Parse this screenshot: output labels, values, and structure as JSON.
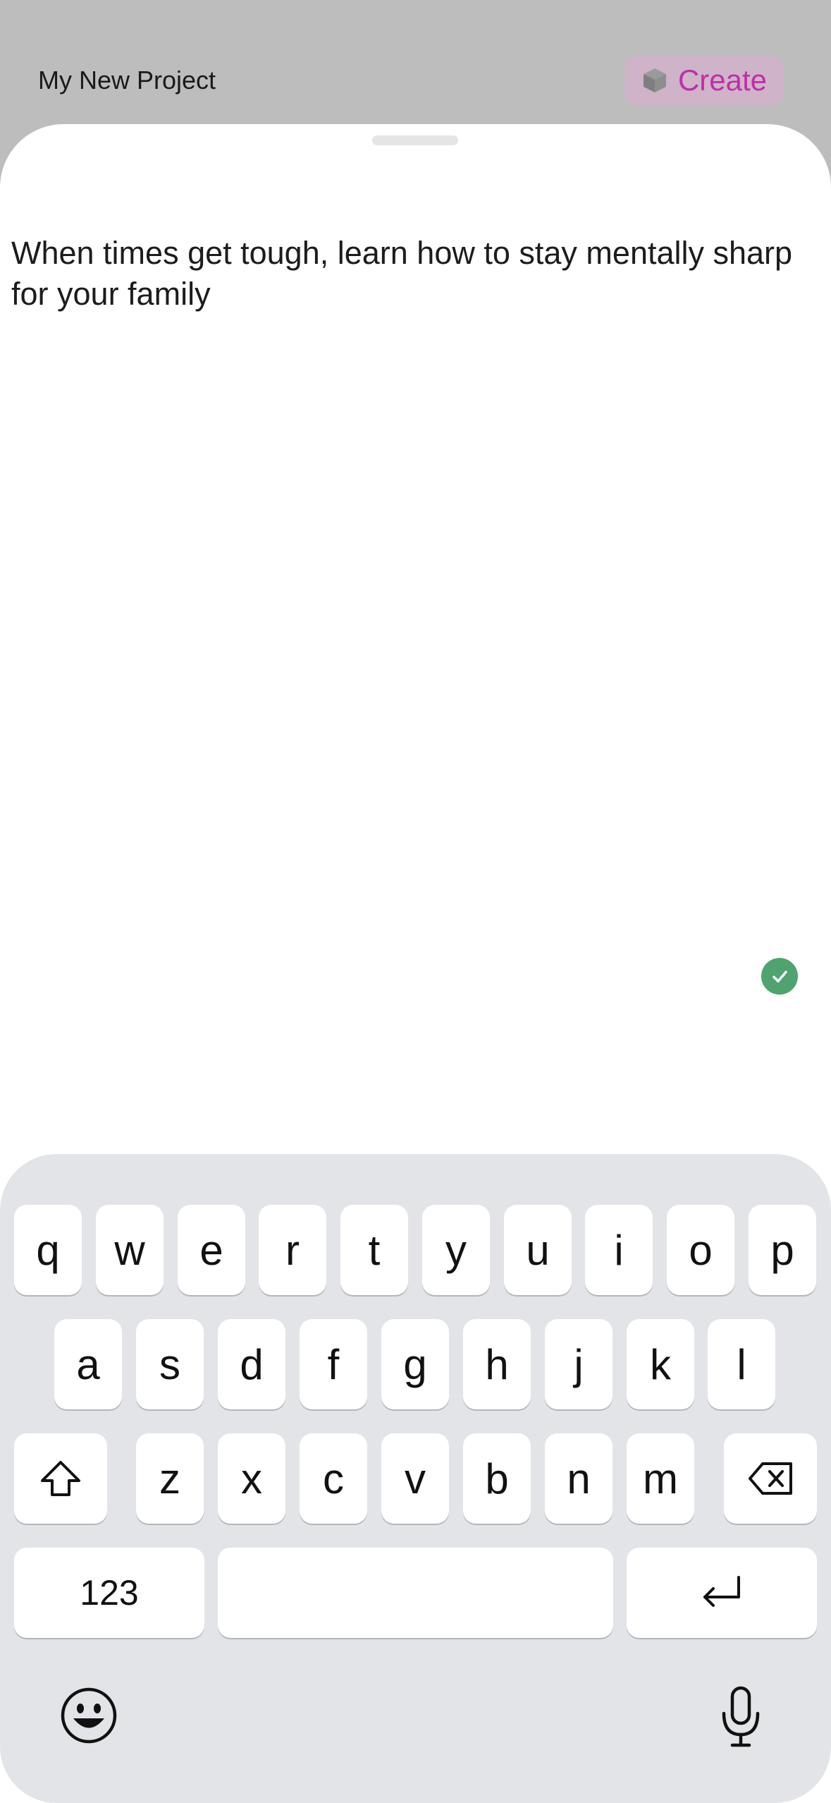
{
  "header": {
    "project_title": "My New Project",
    "create_label": "Create"
  },
  "editor": {
    "text": "When times get tough, learn how to stay mentally sharp for your family"
  },
  "keyboard": {
    "row1": [
      "q",
      "w",
      "e",
      "r",
      "t",
      "y",
      "u",
      "i",
      "o",
      "p"
    ],
    "row2": [
      "a",
      "s",
      "d",
      "f",
      "g",
      "h",
      "j",
      "k",
      "l"
    ],
    "row3": [
      "z",
      "x",
      "c",
      "v",
      "b",
      "n",
      "m"
    ],
    "numbers_label": "123",
    "icons": {
      "shift": "shift-icon",
      "delete": "delete-icon",
      "return": "return-icon",
      "emoji": "emoji-icon",
      "microphone": "microphone-icon"
    }
  },
  "colors": {
    "accent": "#c02ea8",
    "create_bg": "#cfb3c9",
    "check": "#4ea36f",
    "keyboard_bg": "#e3e4e8",
    "backdrop": "#bdbdbd"
  }
}
